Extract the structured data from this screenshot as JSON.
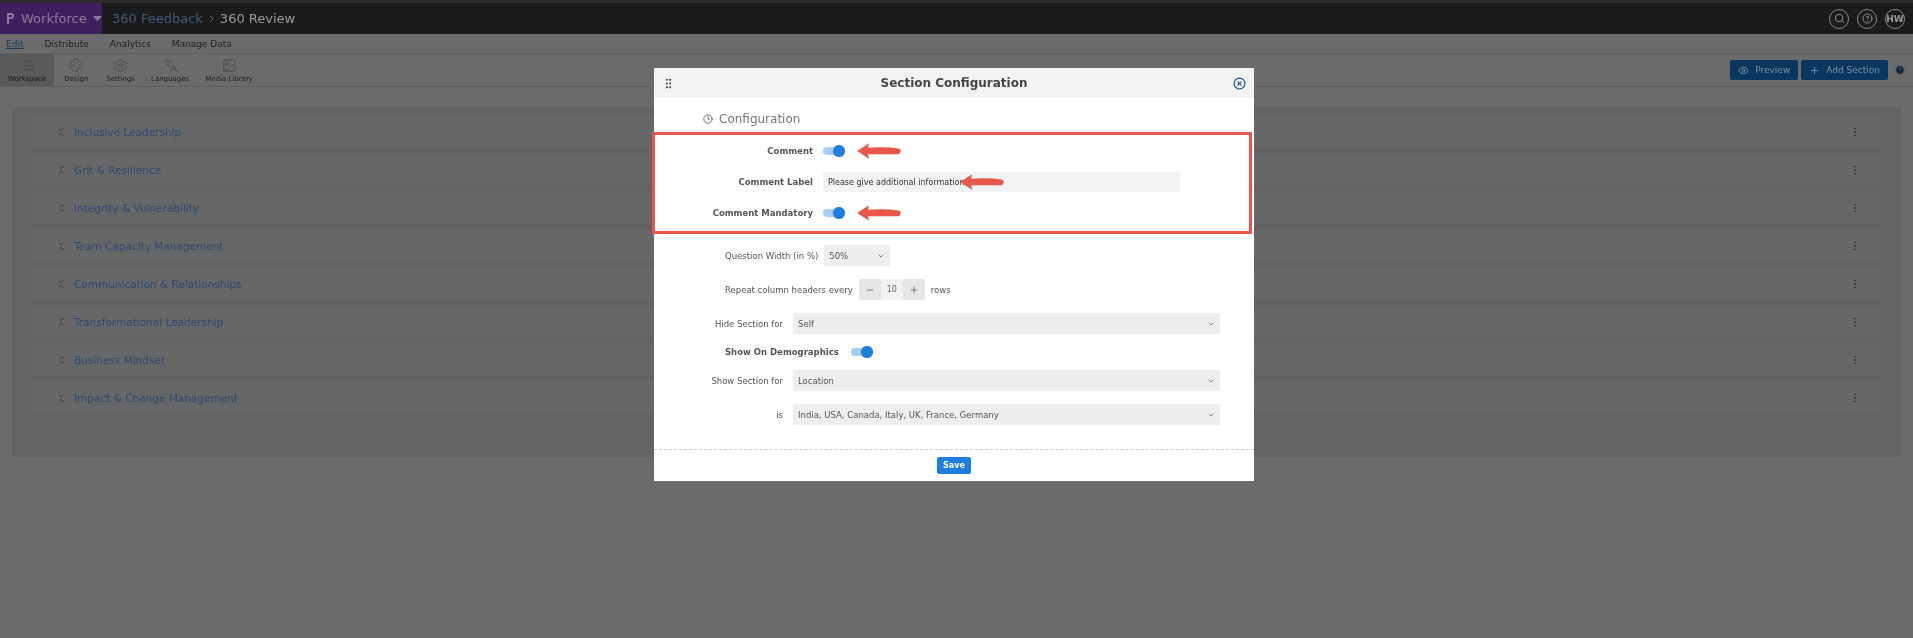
{
  "app_bar": {
    "brand": "Workforce",
    "breadcrumb": [
      "360 Feedback",
      "360 Review"
    ],
    "avatar": "HW"
  },
  "menu": [
    {
      "label": "Edit",
      "selected": true
    },
    {
      "label": "Distribute",
      "selected": false
    },
    {
      "label": "Analytics",
      "selected": false
    },
    {
      "label": "Manage Data",
      "selected": false
    }
  ],
  "toolbar": [
    {
      "label": "Workspace",
      "kind": "workspace",
      "selected": true
    },
    {
      "label": "Design",
      "kind": "design",
      "selected": false
    },
    {
      "label": "Settings",
      "kind": "settings",
      "selected": false
    },
    {
      "label": "Languages",
      "kind": "languages",
      "selected": false
    },
    {
      "label": "Media Library",
      "kind": "media",
      "selected": false
    }
  ],
  "actions": [
    {
      "label": "Preview",
      "kind": "preview"
    },
    {
      "label": "Add Section",
      "kind": "add"
    }
  ],
  "sections": [
    {
      "title": "Inclusive Leadership"
    },
    {
      "title": "Grit & Resilience"
    },
    {
      "title": "Integrity & Vulnerability"
    },
    {
      "title": "Team Capacity Management"
    },
    {
      "title": "Communication & Relationships"
    },
    {
      "title": "Transformational Leadership"
    },
    {
      "title": "Business Mindset"
    },
    {
      "title": "Impact & Change Management"
    }
  ],
  "dialog": {
    "title": "Section Configuration",
    "heading": "Configuration",
    "annotated": [
      {
        "kind": "toggle",
        "label": "Comment",
        "on": true
      },
      {
        "kind": "text",
        "label": "Comment Label",
        "value": "Please give additional information"
      },
      {
        "kind": "toggle",
        "label": "Comment Mandatory",
        "on": true
      }
    ],
    "settings": [
      {
        "kind": "short-select",
        "label": "Question Width (in %)",
        "value": "50%"
      },
      {
        "kind": "stepper",
        "label": "Repeat column headers every",
        "value": "10",
        "suffix": "rows"
      },
      {
        "kind": "select",
        "label": "Hide Section for",
        "value": "Self"
      },
      {
        "kind": "toggle",
        "label": "Show On Demographics",
        "on": true
      },
      {
        "kind": "select",
        "label": "Show Section for",
        "value": "Location"
      },
      {
        "kind": "select",
        "label": "is",
        "value": "India, USA, Canada, Italy, UK, France, Germany"
      }
    ],
    "save": "Save"
  }
}
